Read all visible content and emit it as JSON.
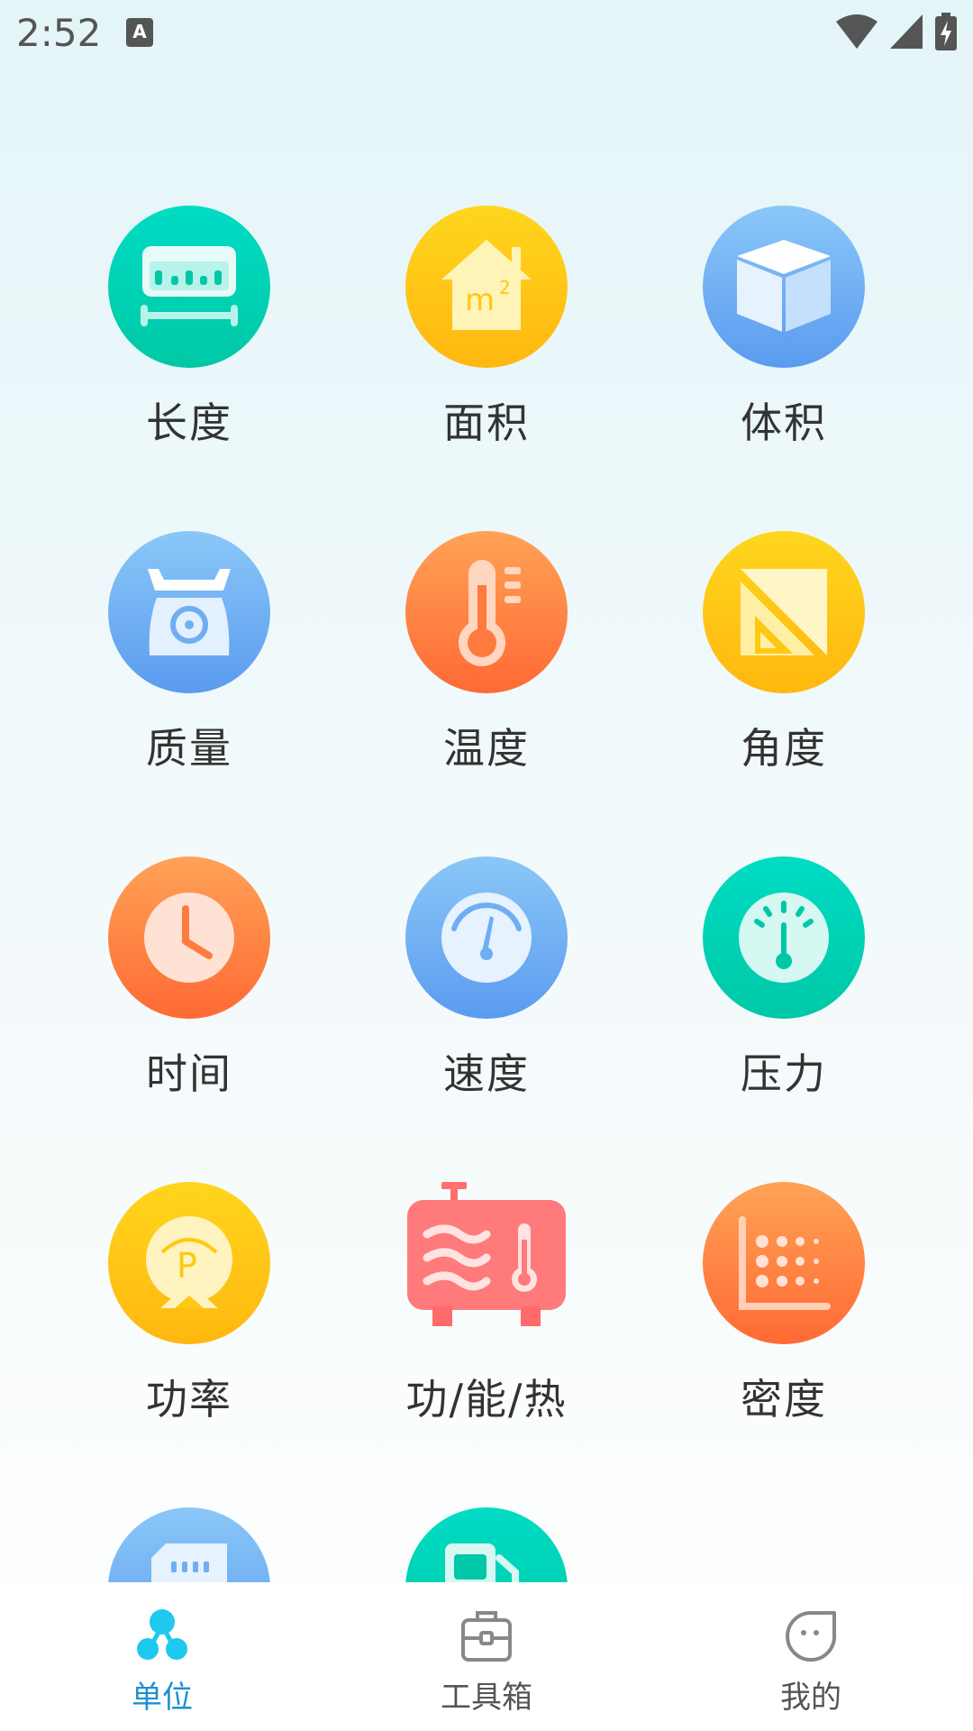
{
  "status_bar": {
    "time": "2:52",
    "notification_icon": "A"
  },
  "grid": {
    "items": [
      {
        "label": "长度",
        "icon": "ruler-icon",
        "color": "#00d4b8"
      },
      {
        "label": "面积",
        "icon": "area-m2-icon",
        "color": "#ffc812"
      },
      {
        "label": "体积",
        "icon": "cube-icon",
        "color": "#6eaef2"
      },
      {
        "label": "质量",
        "icon": "scale-icon",
        "color": "#6eaef2"
      },
      {
        "label": "温度",
        "icon": "thermometer-icon",
        "color": "#ff8244"
      },
      {
        "label": "角度",
        "icon": "set-square-icon",
        "color": "#ffc812"
      },
      {
        "label": "时间",
        "icon": "clock-icon",
        "color": "#ff8244"
      },
      {
        "label": "速度",
        "icon": "speedometer-icon",
        "color": "#6eaef2"
      },
      {
        "label": "压力",
        "icon": "pressure-gauge-icon",
        "color": "#00d4b8"
      },
      {
        "label": "功率",
        "icon": "power-icon",
        "color": "#ffc812"
      },
      {
        "label": "功/能/热",
        "icon": "boiler-icon",
        "color": "#ff7070"
      },
      {
        "label": "密度",
        "icon": "density-icon",
        "color": "#ff8244"
      },
      {
        "label": "",
        "icon": "storage-card-icon",
        "color": "#6eaef2"
      },
      {
        "label": "",
        "icon": "fuel-icon",
        "color": "#00d4b8"
      }
    ]
  },
  "bottom_nav": {
    "items": [
      {
        "label": "单位",
        "icon": "units-icon",
        "active": true,
        "color": "#1ec8ef"
      },
      {
        "label": "工具箱",
        "icon": "toolbox-icon",
        "active": false
      },
      {
        "label": "我的",
        "icon": "profile-face-icon",
        "active": false
      }
    ]
  }
}
